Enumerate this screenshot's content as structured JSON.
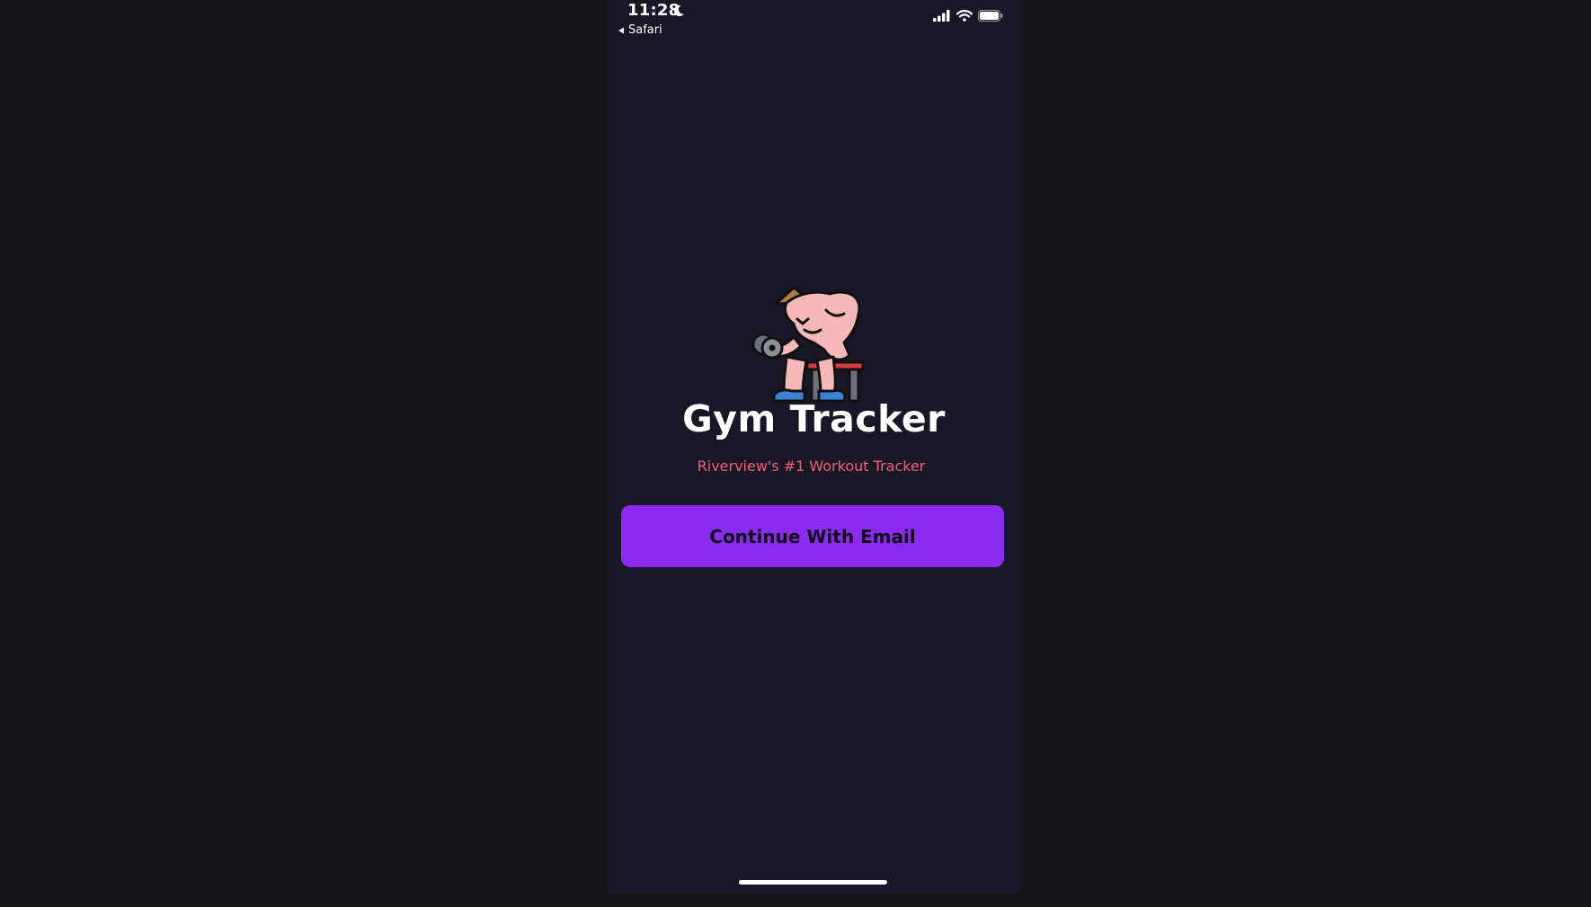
{
  "status_bar": {
    "time": "11:28",
    "back_label": "Safari"
  },
  "icons": {
    "moon": "moon-icon",
    "signal": "cellular-signal-icon",
    "wifi": "wifi-icon",
    "battery": "battery-icon",
    "back": "back-arrow-icon",
    "logo": "gym-man-dumbbell-logo"
  },
  "app": {
    "title": "Gym Tracker",
    "subtitle": "Riverview's #1 Workout Tracker",
    "cta_label": "Continue With Email"
  },
  "colors": {
    "background": "#151419",
    "phone_background": "#171726",
    "accent": "#8b2af0",
    "subtitle": "#f0607a",
    "title": "#ffffff"
  }
}
